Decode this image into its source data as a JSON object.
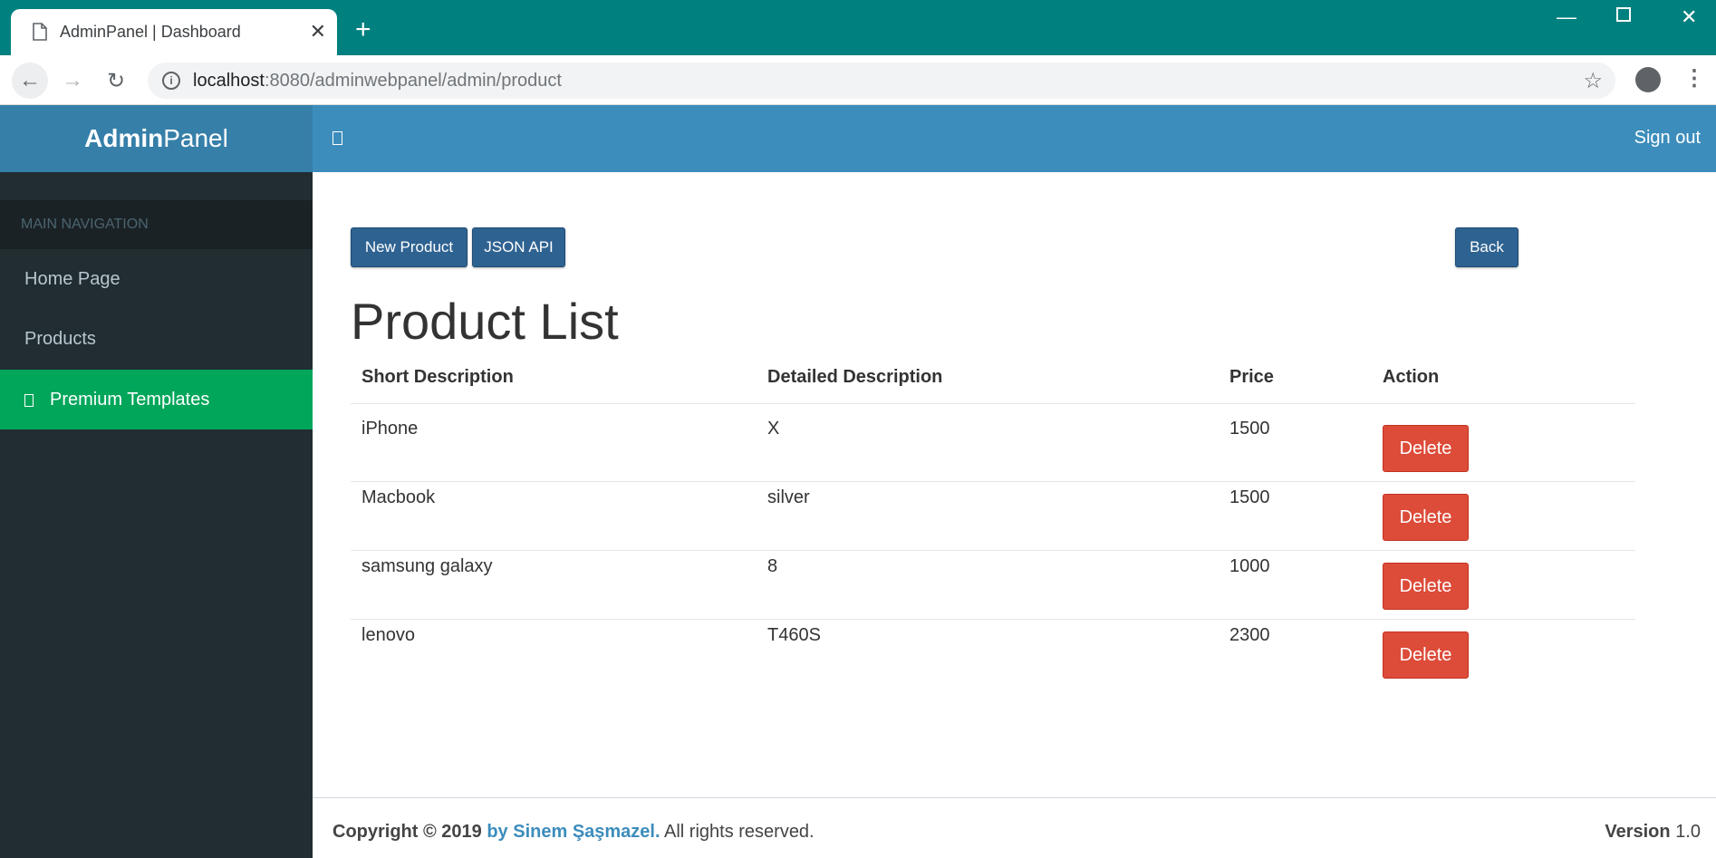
{
  "browser": {
    "tab_title": "AdminPanel | Dashboard",
    "url_host": "localhost",
    "url_path": ":8080/adminwebpanel/admin/product"
  },
  "sidebar": {
    "logo_bold": "Admin",
    "logo_light": "Panel",
    "nav_header": "MAIN NAVIGATION",
    "items": [
      {
        "label": "Home Page"
      },
      {
        "label": "Products"
      },
      {
        "label": "Premium Templates"
      }
    ]
  },
  "topnav": {
    "signout_label": "Sign out"
  },
  "toolbar": {
    "new_product_label": "New Product",
    "json_api_label": "JSON API",
    "back_label": "Back"
  },
  "page": {
    "title": "Product List"
  },
  "table": {
    "headers": [
      "Short Description",
      "Detailed Description",
      "Price",
      "Action"
    ],
    "rows": [
      {
        "short": "iPhone",
        "detail": "X",
        "price": "1500",
        "action": "Delete"
      },
      {
        "short": "Macbook",
        "detail": "silver",
        "price": "1500",
        "action": "Delete"
      },
      {
        "short": "samsung galaxy",
        "detail": "8",
        "price": "1000",
        "action": "Delete"
      },
      {
        "short": "lenovo",
        "detail": "T460S",
        "price": "2300",
        "action": "Delete"
      }
    ]
  },
  "footer": {
    "copyright": "Copyright © 2019",
    "author": "by Sinem Şaşmazel.",
    "rights": "All rights reserved.",
    "version_label": "Version",
    "version_value": "1.0"
  }
}
